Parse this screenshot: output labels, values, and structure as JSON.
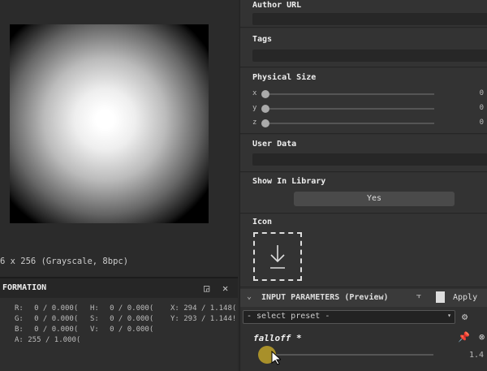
{
  "viewer": {
    "image_info": "6 x 256 (Grayscale, 8bpc)"
  },
  "information": {
    "title": "FORMATION",
    "rgba": [
      {
        "k": "R:",
        "v": "0 / 0.000("
      },
      {
        "k": "G:",
        "v": "0 / 0.000("
      },
      {
        "k": "B:",
        "v": "0 / 0.000("
      },
      {
        "k": "A:",
        "v": "255 / 1.000("
      }
    ],
    "hsv": [
      {
        "k": "H:",
        "v": "0 / 0.000("
      },
      {
        "k": "S:",
        "v": "0 / 0.000("
      },
      {
        "k": "V:",
        "v": "0 / 0.000("
      }
    ],
    "xy": [
      {
        "k": "X:",
        "v": "294 / 1.148("
      },
      {
        "k": "Y:",
        "v": "293 / 1.144!"
      }
    ]
  },
  "properties": {
    "author_url": "Author URL",
    "tags": "Tags",
    "physical_size": "Physical Size",
    "axes": [
      {
        "k": "x",
        "v": "0"
      },
      {
        "k": "y",
        "v": "0"
      },
      {
        "k": "z",
        "v": "0"
      }
    ],
    "user_data": "User Data",
    "show_in_library": "Show In Library",
    "show_value": "Yes",
    "icon": "Icon"
  },
  "params": {
    "title": "INPUT PARAMETERS (Preview)",
    "apply": "Apply",
    "preset": "- select preset -",
    "falloff_label": "falloff *",
    "falloff_value": "1.4"
  }
}
